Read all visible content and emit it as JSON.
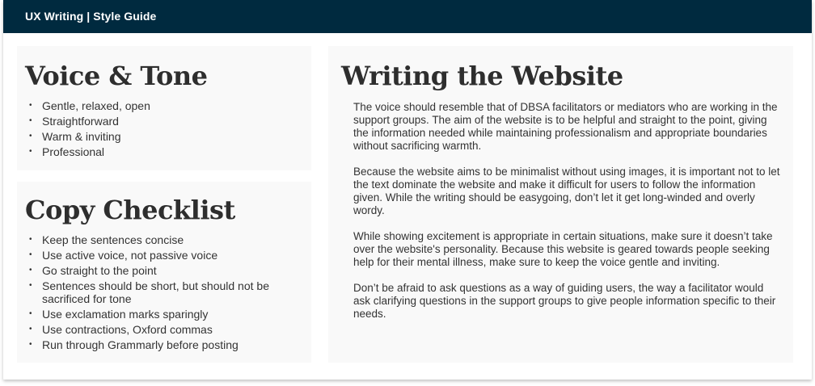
{
  "header": {
    "title": "UX Writing | Style Guide"
  },
  "voice_tone": {
    "heading": "Voice & Tone",
    "items": [
      "Gentle, relaxed, open",
      "Straightforward",
      "Warm & inviting",
      "Professional"
    ]
  },
  "copy_checklist": {
    "heading": "Copy Checklist",
    "items": [
      "Keep the sentences concise",
      "Use active voice, not passive voice",
      "Go straight to the point",
      "Sentences should be short, but should not be sacrificed for tone",
      "Use exclamation marks sparingly",
      "Use contractions, Oxford commas",
      "Run through Grammarly before posting"
    ]
  },
  "writing_website": {
    "heading": "Writing the Website",
    "paragraphs": [
      "The voice should resemble that of DBSA facilitators or mediators who are working in the support groups. The aim of the website is to be helpful and straight to the point, giving the information needed while maintaining professionalism and appropriate boundaries without sacrificing warmth.",
      "Because the website aims to be minimalist without using images, it is important not to let the text dominate the website and make it difficult for users to follow the information given. While the writing should be easygoing, don’t let it get long-winded and overly wordy.",
      "While showing excitement is appropriate in certain situations, make sure it doesn’t take over the website's personality. Because this website is geared towards people seeking help for their mental illness, make sure to keep the voice gentle and inviting.",
      "Don’t be afraid to ask questions as a way of guiding users, the way a facilitator would ask clarifying questions in the support groups to give people information specific to their needs."
    ]
  },
  "colors": {
    "header_bg": "#002a3f",
    "card_bg": "#f9f9f9",
    "heading_text": "#2e2e2e",
    "body_text": "#333333"
  }
}
